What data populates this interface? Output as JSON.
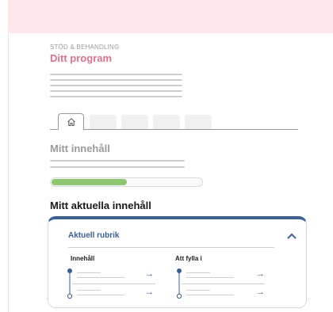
{
  "header": {
    "eyebrow": "STÖD & BEHANDLING",
    "title": "Ditt program"
  },
  "tabs": [
    {
      "name": "home",
      "icon": "home-icon",
      "active": true
    },
    {
      "name": "tab-2",
      "active": false
    },
    {
      "name": "tab-3",
      "active": false
    },
    {
      "name": "tab-4",
      "active": false
    },
    {
      "name": "tab-5",
      "active": false
    }
  ],
  "my_content": {
    "title": "Mitt innehåll",
    "progress": 0.5
  },
  "current": {
    "title": "Mitt aktuella innehåll",
    "card_title": "Aktuell rubrik",
    "col_left": "Innehåll",
    "col_right": "Att fylla i",
    "arrow": "→"
  },
  "colors": {
    "accent": "#3b5f9a",
    "brand_pink": "#d8738a",
    "progress": "#8dc76e",
    "topbar": "#fce8ea"
  }
}
